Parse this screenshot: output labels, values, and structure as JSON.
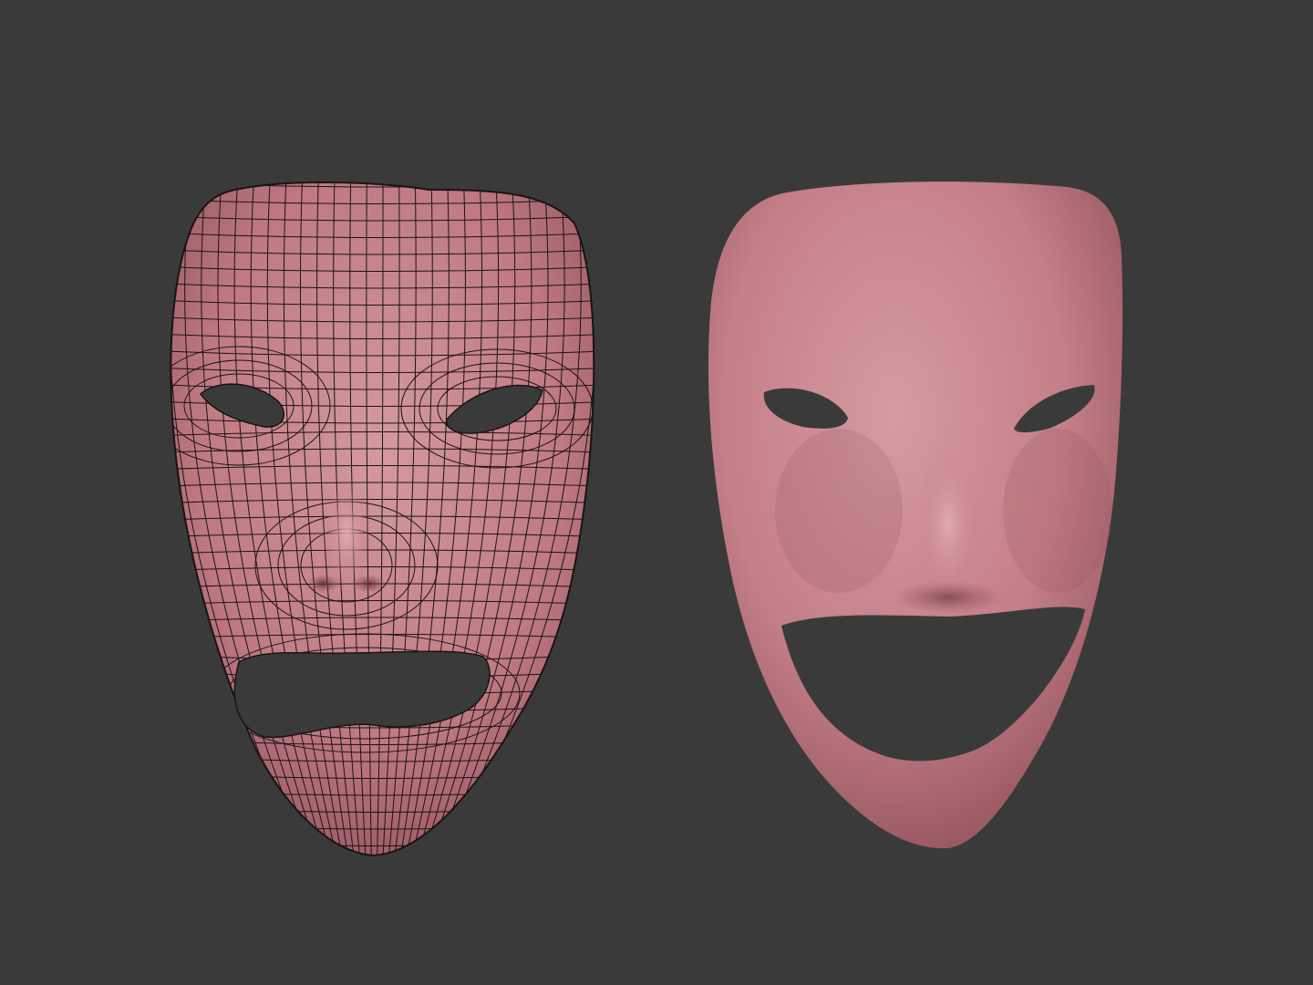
{
  "scene": {
    "background_color": "#3a3a3a",
    "skin_color": "#c07a82",
    "skin_highlight": "#d39aa0",
    "skin_shadow": "#8e4f58",
    "wire_color": "#1a1414",
    "hole_color": "#3a3a3a"
  },
  "masks": [
    {
      "name": "tragedy-mask",
      "style": "wireframe-topology",
      "expression": "sad"
    },
    {
      "name": "comedy-mask",
      "style": "smooth-shaded",
      "expression": "happy"
    }
  ]
}
